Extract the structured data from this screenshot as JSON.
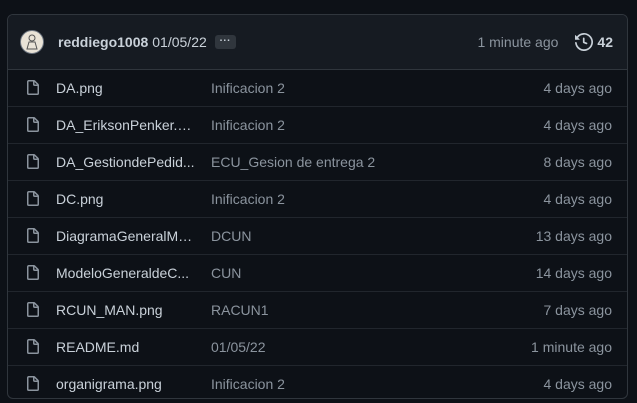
{
  "commit": {
    "author": "reddiego1008",
    "message": "01/05/22",
    "more_label": "...",
    "time_ago": "1 minute ago",
    "commit_count": "42"
  },
  "files": [
    {
      "name": "DA.png",
      "message": "Inificacion 2",
      "time": "4 days ago"
    },
    {
      "name": "DA_EriksonPenker.png",
      "message": "Inificacion 2",
      "time": "4 days ago"
    },
    {
      "name": "DA_GestiondePedid...",
      "message": "ECU_Gesion de entrega 2",
      "time": "8 days ago"
    },
    {
      "name": "DC.png",
      "message": "Inificacion 2",
      "time": "4 days ago"
    },
    {
      "name": "DiagramaGeneralMC...",
      "message": "DCUN",
      "time": "13 days ago"
    },
    {
      "name": "ModeloGeneraldeC...",
      "message": "CUN",
      "time": "14 days ago"
    },
    {
      "name": "RCUN_MAN.png",
      "message": "RACUN1",
      "time": "7 days ago"
    },
    {
      "name": "README.md",
      "message": "01/05/22",
      "time": "1 minute ago"
    },
    {
      "name": "organigrama.png",
      "message": "Inificacion 2",
      "time": "4 days ago"
    }
  ],
  "icons": {
    "file": "file-icon",
    "history": "history-icon"
  },
  "colors": {
    "background": "#0d1117",
    "header": "#161b22",
    "border": "#30363d",
    "muted": "#8b949e",
    "text": "#c9d1d9"
  }
}
